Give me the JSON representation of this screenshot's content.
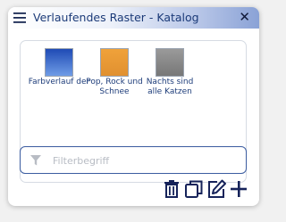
{
  "window": {
    "title": "Verlaufendes Raster - Katalog",
    "menu_icon": "hamburger-menu-icon",
    "close_icon": "close-icon",
    "close_glyph": "✕"
  },
  "catalog": {
    "items": [
      {
        "label": "Farbverlauf der",
        "colors": [
          "#1f4bb5",
          "#6f9ce6"
        ]
      },
      {
        "label": "Pop, Rock und Schnee",
        "colors": [
          "#f0a23a",
          "#e09030"
        ]
      },
      {
        "label": "Nachts sind alle Katzen",
        "colors": [
          "#9a9a9a",
          "#777777"
        ]
      }
    ]
  },
  "filter": {
    "placeholder": "Filterbegriff",
    "value": "",
    "icon": "filter-funnel-icon"
  },
  "toolbar": {
    "icons": [
      "delete-icon",
      "duplicate-icon",
      "edit-icon",
      "add-icon"
    ]
  },
  "colors": {
    "accent": "#1b3a78",
    "filter_border": "#3b5ca0"
  }
}
